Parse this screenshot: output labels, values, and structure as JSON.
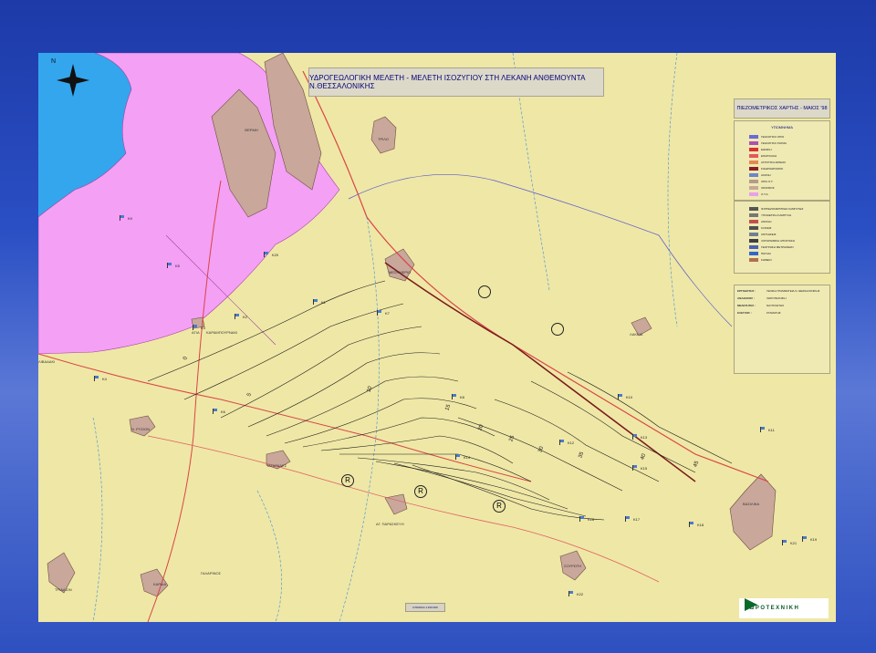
{
  "title": "ΥΔΡΟΓΕΩΛΟΓΙΚΗ ΜΕΛΕΤΗ - ΜΕΛΕΤΗ ΙΣΟΖΥΓΙΟΥ ΣΤΗ ΛΕΚΑΝΗ ΑΝΘΕΜΟΥΝΤΑ Ν.ΘΕΣΣΑΛΟΝΙΚΗΣ",
  "subtitle": "ΠΙΕΖΟΜΕΤΡΙΚΟΣ ΧΑΡΤΗΣ - ΜΑΙΟΣ '98",
  "north_label": "N",
  "legend1": {
    "heading": "ΥΠΟΜΝΗΜΑ",
    "items": [
      {
        "label": "ΓΕΩΛΟΓΙΚΟ ΟΡΙΟ",
        "color": "#6b6bd6"
      },
      {
        "label": "ΓΕΩΛΟΓΙΚΟ ΡΗΓΜΑ",
        "color": "#b04fb0"
      },
      {
        "label": "ΕΘΝΙΚΗ",
        "color": "#d63232"
      },
      {
        "label": "ΕΠΑΡΧΙΑΚΗ",
        "color": "#e05a5a"
      },
      {
        "label": "ΑΓΡΟΤΙΚΗ ΑΙΡΕΩΝ",
        "color": "#e28a50"
      },
      {
        "label": "ΣΙΔΗΡΟΔΡΟΜΟΣ",
        "color": "#8a2020"
      },
      {
        "label": "ΑΚΟΝΗ",
        "color": "#6b86c8"
      },
      {
        "label": "ΟΡΙΑ Ο.Τ.",
        "color": "#b69a8a"
      },
      {
        "label": "ΟΙΚΙΣΜΟΣ",
        "color": "#c7a79a"
      },
      {
        "label": "Ο.Τ.Α.",
        "color": "#e8a0e8"
      }
    ]
  },
  "legend2": {
    "items": [
      {
        "label": "ΙΣΟΠΙΕΖΟΜΕΤΡΙΚΕΣ ΚΑΜΠΥΛΕΣ",
        "color": "#555555"
      },
      {
        "label": "ΥΠΟΘΕΤΙΚΗ ΚΑΜΠΥΛΗ",
        "color": "#777777"
      },
      {
        "label": "ΑΝΟΙΞΗ",
        "color": "#c05050"
      },
      {
        "label": "ΚΛΙΣΕΙΣ",
        "color": "#505050"
      },
      {
        "label": "ΑΝΤΛΗΣΕΙΣ",
        "color": "#708090"
      },
      {
        "label": "ΛΟΓΑΡΙΘΜΙΚΗ ΑΠΟΣΤΑΣΗ",
        "color": "#404040"
      },
      {
        "label": "ΓΕΩΤΡΗΣΗ ΜΕΤΡΗΣΕΩΝ",
        "color": "#4a60b0"
      },
      {
        "label": "ΠΗΓΑΔΙ",
        "color": "#3366cc"
      },
      {
        "label": "ΣΗΜΕΙΟ",
        "color": "#b07050"
      }
    ]
  },
  "info": {
    "ergodotis_label": "ΕΡΓΟΔΟΤΗΣ :",
    "ergodotis_value": "ΓΕΝΙΚΗ ΓΡΑΜΜΑΤΕΙΑ Ν. ΘΕΣΣΑΛΟΝΙΚΗΣ",
    "anadoxos_label": "ΑΝΑΔΟΧΟΣ :",
    "anadoxos_value": "ΧΩΡΟΤΕΧΝΙΚΗ",
    "meletites_label": "ΜΕΛΕΤΗΤΕΣ :",
    "meletites_value": "ΝΑΥΠΛΙΩΤΗΣ",
    "elegxos_label": "ΕΛΕΓΧΟΣ :",
    "elegxos_value": "ΣΤΑΜΑΤΗΣ"
  },
  "scale_text": "ΚΛΙΜΑΚΑ 1:100.000",
  "logo_text": "ΧΩΡΟΤΕΧΝΙΚΗ",
  "places": [
    {
      "name": "ΘΕΡΜΗ",
      "id": "thermi"
    },
    {
      "name": "ΤΡΙΛΟ",
      "id": "trilo"
    },
    {
      "name": "Ν. ΡΥΣΙΟΝ",
      "id": "rysio"
    },
    {
      "name": "ΤΑΓΑΡΑΔΕΣ",
      "id": "tagarades"
    },
    {
      "name": "ΑΓ. ΠΑΡΑΣΚΕΥΗ",
      "id": "paraskevi"
    },
    {
      "name": "ΓΑΛΑΡΙΝΟΣ",
      "id": "galarinos"
    },
    {
      "name": "ΒΑΣΙΛΙΚΑ",
      "id": "vasilika"
    },
    {
      "name": "ΣΟΥΡΩΤΗ",
      "id": "souroti"
    },
    {
      "name": "ΚΑΡΔΙΑ",
      "id": "kardia"
    },
    {
      "name": "ΤΡΙΑΔΙΟΝ",
      "id": "triadio"
    },
    {
      "name": "ΛΑΚΚΙΑ",
      "id": "lakkia"
    },
    {
      "name": "ΑΓΙΑ",
      "id": "agia"
    },
    {
      "name": "ΚΑΡΑΜΠΟΥΡΝΑΚΙ",
      "id": "karabournaki"
    },
    {
      "name": "ΜΕΣΗΜΕΡΙΟ",
      "id": "mesimerio"
    },
    {
      "name": "ΛΙΒΑΔΑΚΙ",
      "id": "livadaki"
    }
  ],
  "wells": [
    "Κ9",
    "Κ20",
    "Κ5",
    "Κ1",
    "Κ2",
    "Κ3",
    "Κ4",
    "Κ6",
    "Κ7",
    "Κ8",
    "Κ10",
    "Κ11",
    "Κ12",
    "Κ13",
    "Κ14",
    "Κ15",
    "Κ16",
    "Κ17",
    "Κ18",
    "Κ19",
    "Κ21",
    "Κ22"
  ],
  "contour_labels": [
    "0",
    "5",
    "10",
    "15",
    "20",
    "25",
    "30",
    "35",
    "40",
    "45"
  ],
  "r_markers": [
    "R",
    "R",
    "R"
  ]
}
